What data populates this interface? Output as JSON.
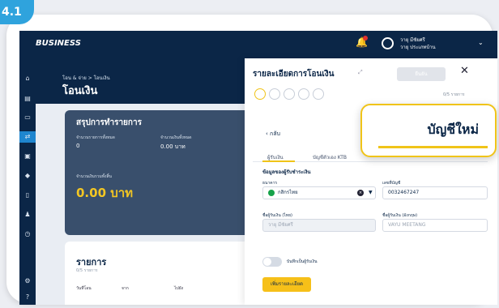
{
  "step_badge": "4.1",
  "topbar": {
    "brand": "BUSINESS",
    "user_name": "วายุ มีชัยศรี",
    "user_company": "วายุ ประเภทบ้าน"
  },
  "breadcrumb": "โอน & จ่าย > โอนเงิน",
  "page_title": "โอนเงิน",
  "summary": {
    "title": "สรุปการทำรายการ",
    "label_count": "จำนวนรายการทั้งหมด",
    "count": "0",
    "label_amount": "จำนวนเงินทั้งหมด",
    "amount": "0.00 บาท",
    "label_total": "จำนวนเงินรวมทั้งสิ้น",
    "total": "0.00 บาท"
  },
  "list": {
    "title": "รายการ",
    "subtitle": "0/5 รายการ",
    "columns": [
      "วันที่โอน",
      "จาก",
      "ไปยัง"
    ]
  },
  "panel": {
    "title": "รายละเอียดการโอนเงิน",
    "confirm": "ยืนยัน",
    "step_count": "0/5 รายการ",
    "back": "กลับ",
    "tabs": [
      "ผู้รับเงิน",
      "บัญชีตัวเอง KTB"
    ],
    "section": "ข้อมูลของผู้รับชำระเงิน",
    "bank_label": "ธนาคาร",
    "bank_value": "กสิกรไทย",
    "account_label": "เลขที่บัญชี",
    "account_value": "0032467247",
    "name_th_label": "ชื่อผู้รับเงิน (ไทย)",
    "name_th_value": "วายุ มีชัยศรี",
    "name_en_label": "ชื่อผู้รับเงิน (อังกฤษ)",
    "name_en_value": "VAYU MEETANG",
    "save_label": "บันทึกเป็นผู้รับเงิน",
    "add_button": "เพิ่มรายละเอียด"
  },
  "callout": "บัญชีใหม่",
  "colors": {
    "navy": "#0b2647",
    "accent": "#f0c419",
    "badge": "#2fa3dd"
  }
}
